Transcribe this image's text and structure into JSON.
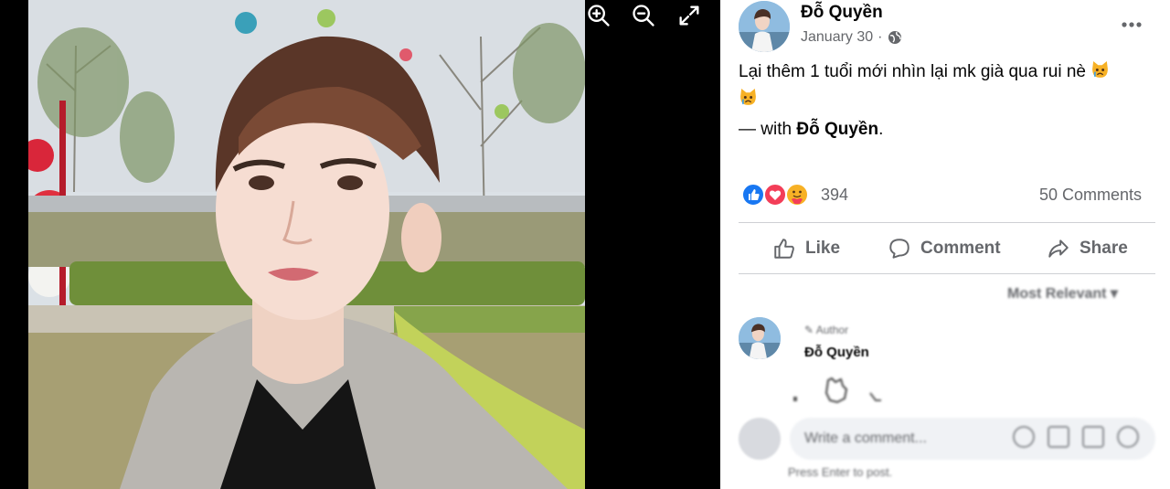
{
  "viewer": {
    "tools": [
      {
        "name": "zoom-in-icon"
      },
      {
        "name": "zoom-out-icon"
      },
      {
        "name": "fullscreen-icon"
      }
    ]
  },
  "post": {
    "author": "Đỗ Quyền",
    "date": "January 30",
    "date_sep": "·",
    "audience_icon": "globe-icon",
    "caption": "Lại thêm 1 tuổi mới nhìn lại mk già qua rui nè",
    "caption_emoji": "crying-cat-emoji",
    "with_prefix": "— with",
    "with_name": "Đỗ Quyền",
    "with_suffix": ".",
    "reactions": [
      "like-reaction-icon",
      "love-reaction-icon",
      "care-reaction-icon"
    ],
    "reaction_count": "394",
    "comments_count": "50 Comments"
  },
  "actions": {
    "like": "Like",
    "comment": "Comment",
    "share": "Share"
  },
  "comments": {
    "sort_label": "Most Relevant",
    "items": [
      {
        "badge": "Author",
        "name": "Đỗ Quyền"
      }
    ],
    "input_placeholder": "Write a comment...",
    "input_hint": "Press Enter to post."
  },
  "colors": {
    "like_blue": "#1877f2",
    "love_red": "#f33e58",
    "care_yellow": "#f7b125",
    "muted_text": "#65676b"
  }
}
